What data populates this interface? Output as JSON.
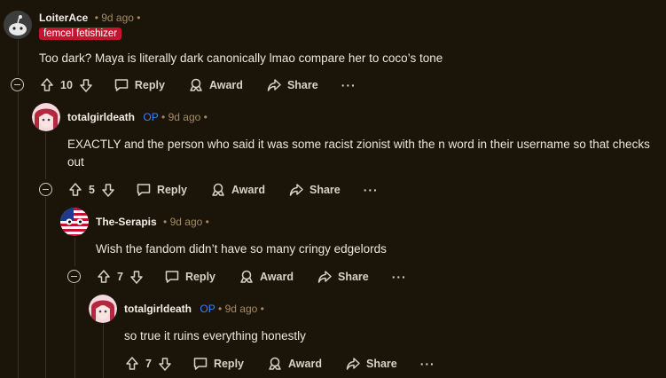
{
  "comments": [
    {
      "author": "LoiterAce",
      "time": "9d ago",
      "flair": "femcel fetishizer",
      "body": "Too dark? Maya is literally dark canonically lmao compare her to coco’s tone",
      "score": "10"
    },
    {
      "author": "totalgirldeath",
      "op": "OP",
      "time": "9d ago",
      "body": "EXACTLY and the person who said it was some racist zionist with the n word in their username so that checks out",
      "score": "5"
    },
    {
      "author": "The-Serapis",
      "time": "9d ago",
      "body": "Wish the fandom didn’t have so many cringy edgelords",
      "score": "7"
    },
    {
      "author": "totalgirldeath",
      "op": "OP",
      "time": "9d ago",
      "body": "so true it ruins everything honestly",
      "score": "7"
    }
  ],
  "actions": {
    "reply": "Reply",
    "award": "Award",
    "share": "Share",
    "more": "···"
  },
  "separator": "•",
  "colors": {
    "background": "#1b1408",
    "flair": "#c3152f",
    "op": "#3b82f6",
    "meta": "#a68a63"
  }
}
